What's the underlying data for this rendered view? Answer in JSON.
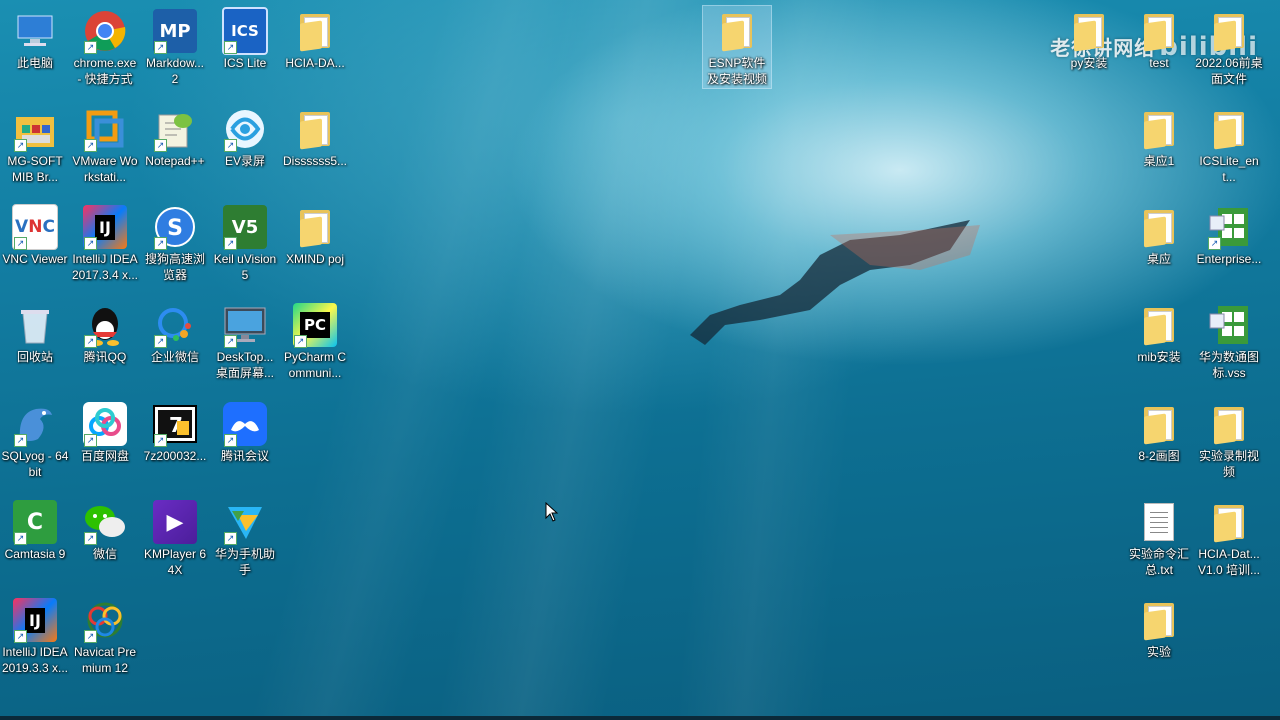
{
  "desktop": {
    "watermark": {
      "text": "老徐讲网络",
      "logo_text": "bilibili"
    },
    "icons_left": [
      {
        "label": "此电脑",
        "icon": "computer-icon"
      },
      {
        "label": "chrome.exe - 快捷方式",
        "icon": "chrome-icon"
      },
      {
        "label": "Markdow... 2",
        "icon": "markdown-icon"
      },
      {
        "label": "ICS Lite",
        "icon": "ics-icon"
      },
      {
        "label": "HCIA-DA...",
        "icon": "folder-icon"
      },
      {
        "label": "MG-SOFT MIB Br...",
        "icon": "mib-browser-icon"
      },
      {
        "label": "VMware Workstati...",
        "icon": "vmware-icon"
      },
      {
        "label": "Notepad++",
        "icon": "notepad-icon"
      },
      {
        "label": "EV录屏",
        "icon": "ev-recorder-icon"
      },
      {
        "label": "Dissssss5...",
        "icon": "folder-icon"
      },
      {
        "label": "VNC Viewer",
        "icon": "vnc-icon"
      },
      {
        "label": "IntelliJ IDEA 2017.3.4 x...",
        "icon": "intellij-icon"
      },
      {
        "label": "搜狗高速浏览器",
        "icon": "sogou-browser-icon"
      },
      {
        "label": "Keil uVision5",
        "icon": "keil-icon"
      },
      {
        "label": "XMIND poj",
        "icon": "folder-icon"
      },
      {
        "label": "回收站",
        "icon": "recycle-bin-icon"
      },
      {
        "label": "腾讯QQ",
        "icon": "qq-icon"
      },
      {
        "label": "企业微信",
        "icon": "wecom-icon"
      },
      {
        "label": "DeskTop... 桌面屏幕...",
        "icon": "monitor-icon"
      },
      {
        "label": "PyCharm Communi...",
        "icon": "pycharm-icon"
      },
      {
        "label": "SQLyog - 64 bit",
        "icon": "sqlyog-icon"
      },
      {
        "label": "百度网盘",
        "icon": "baidu-netdisk-icon"
      },
      {
        "label": "7z200032...",
        "icon": "7zip-icon"
      },
      {
        "label": "腾讯会议",
        "icon": "tencent-meeting-icon"
      },
      {
        "label": "Camtasia 9",
        "icon": "camtasia-icon"
      },
      {
        "label": "微信",
        "icon": "wechat-icon"
      },
      {
        "label": "KMPlayer 64X",
        "icon": "kmplayer-icon"
      },
      {
        "label": "华为手机助手",
        "icon": "huawei-assistant-icon"
      },
      {
        "label": "IntelliJ IDEA 2019.3.3 x...",
        "icon": "intellij-icon"
      },
      {
        "label": "Navicat Premium 12",
        "icon": "navicat-icon"
      }
    ],
    "icon_center": {
      "label": "ESNP软件及安装视频",
      "icon": "folder-icon"
    },
    "icons_right": [
      {
        "label": "py安装",
        "icon": "folder-icon"
      },
      {
        "label": "test",
        "icon": "folder-icon"
      },
      {
        "label": "2022.06前桌面文件",
        "icon": "folder-icon"
      },
      {
        "label": "桌应1",
        "icon": "folder-icon"
      },
      {
        "label": "ICSLite_ent...",
        "icon": "folder-icon"
      },
      {
        "label": "桌应",
        "icon": "folder-icon"
      },
      {
        "label": "Enterprise...",
        "icon": "visio-icon"
      },
      {
        "label": "mib安装",
        "icon": "folder-icon"
      },
      {
        "label": "华为数通图标.vss",
        "icon": "visio-icon"
      },
      {
        "label": "8-2画图",
        "icon": "folder-icon"
      },
      {
        "label": "实验录制视频",
        "icon": "folder-icon"
      },
      {
        "label": "实验命令汇总.txt",
        "icon": "text-file-icon"
      },
      {
        "label": "HCIA-Dat... V1.0 培训...",
        "icon": "folder-icon"
      },
      {
        "label": "实验",
        "icon": "folder-icon"
      }
    ]
  }
}
